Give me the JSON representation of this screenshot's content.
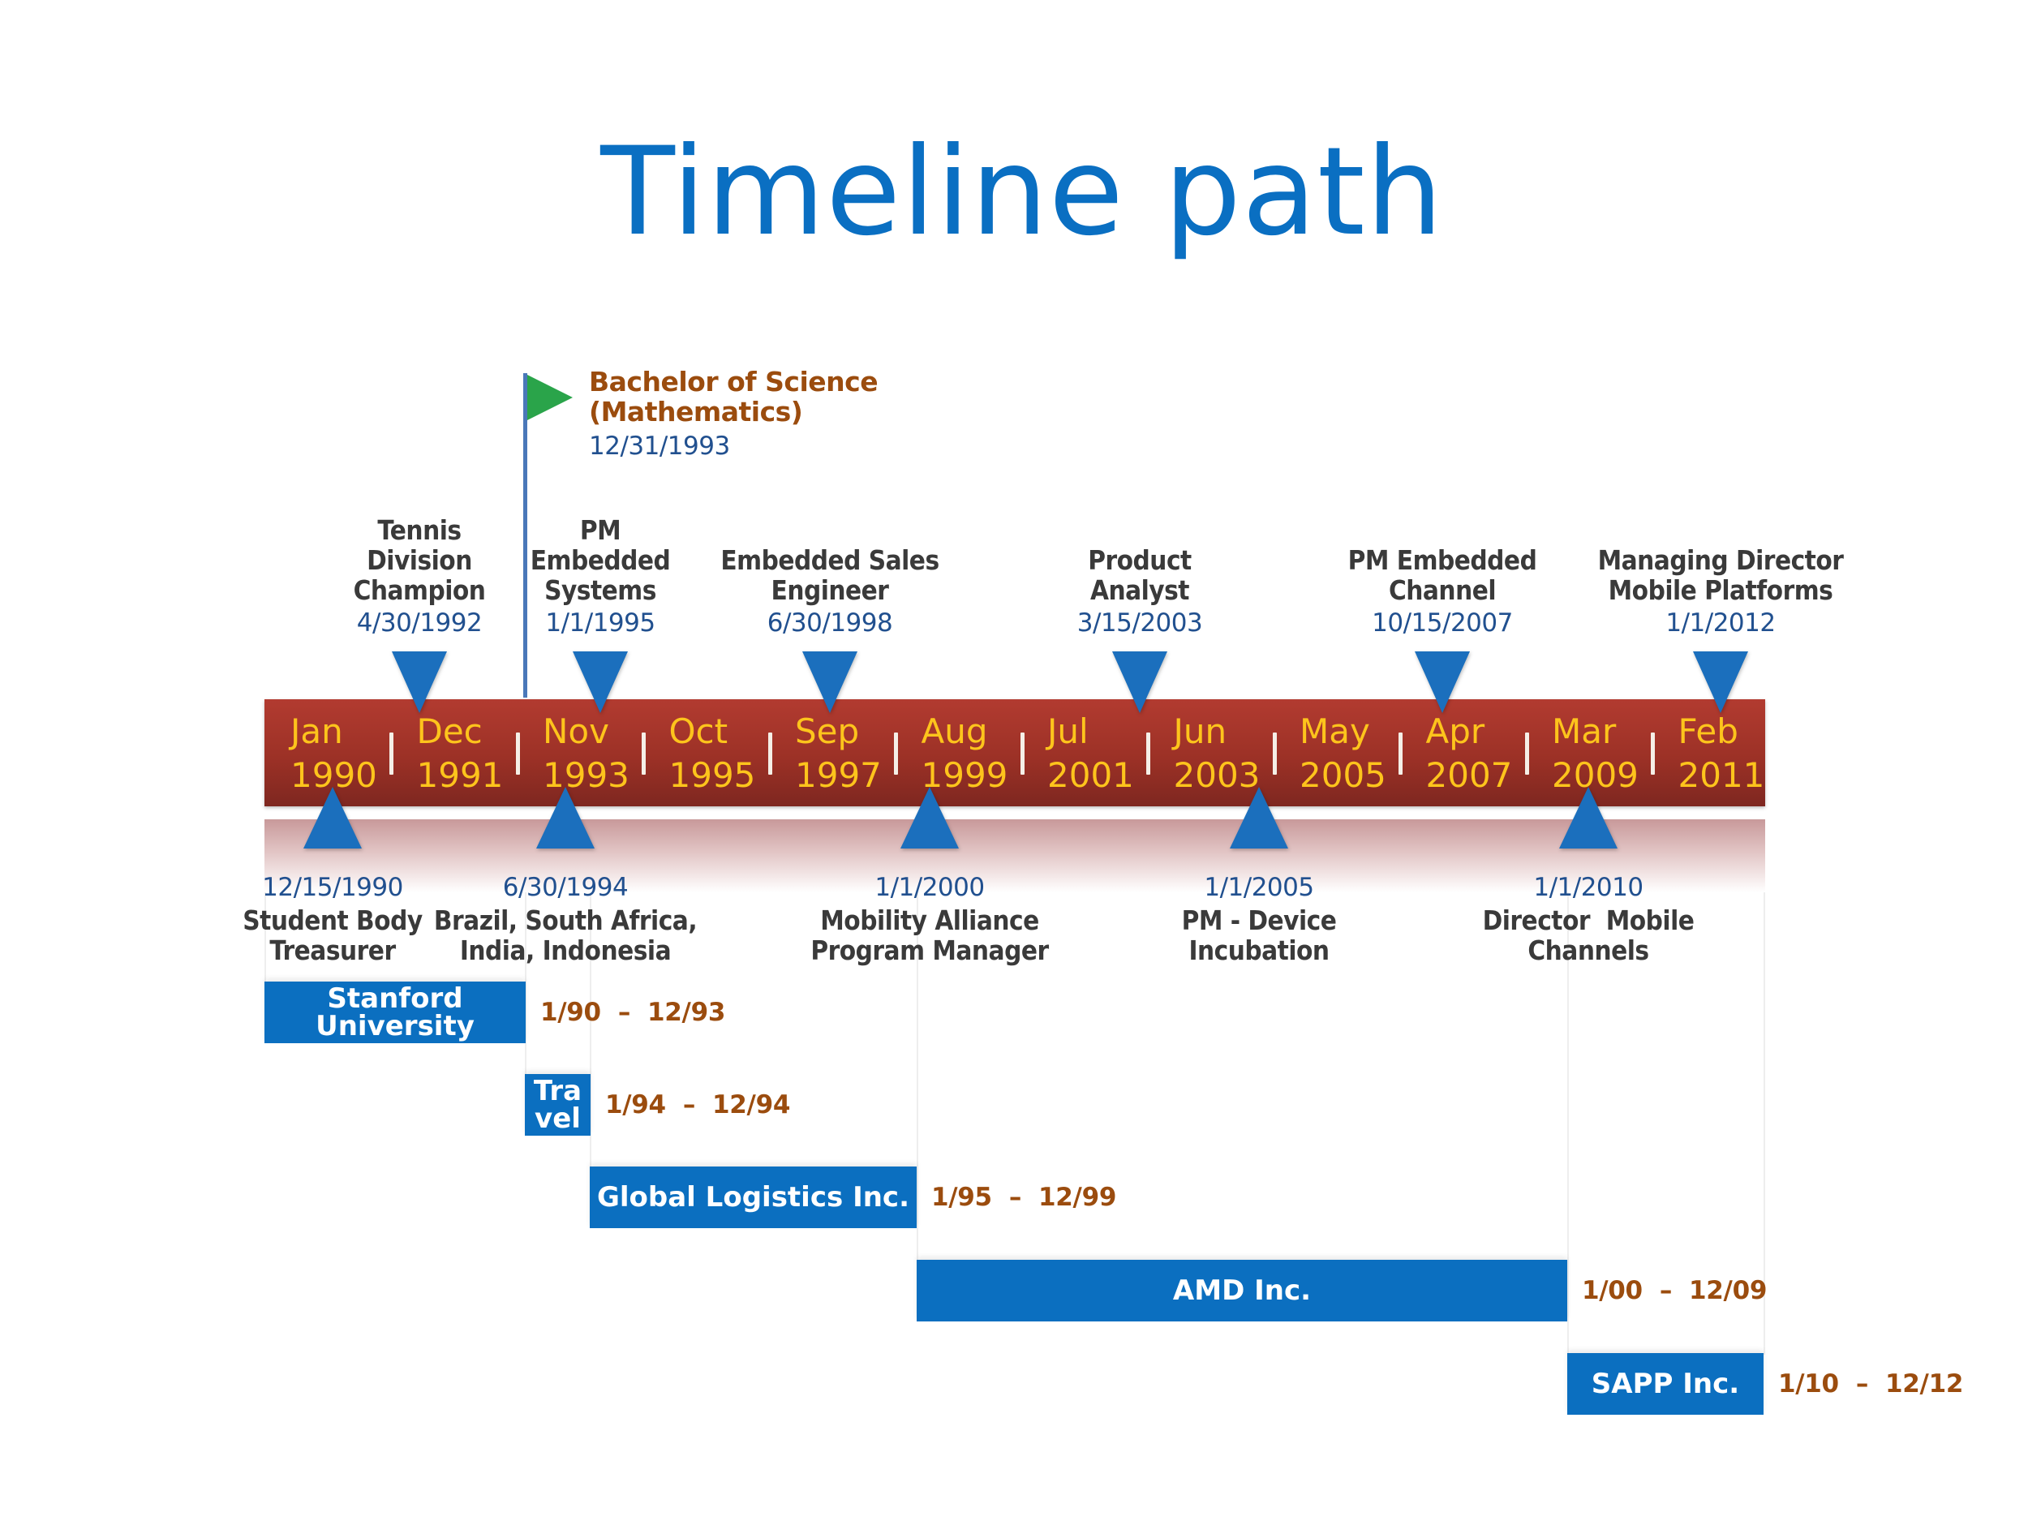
{
  "title": "Timeline path",
  "colors": {
    "title": "#0a6fc2",
    "bar": "#9c3126",
    "period_text": "#fdc41c",
    "marker": "#1b6fbd",
    "flag": "#2aa44a",
    "flag_text": "#9b4c0e",
    "date_text": "#21508f",
    "gantt_bar": "#0b6fc0",
    "range_text": "#9b4c0e"
  },
  "timeline": {
    "periods": [
      {
        "month": "Jan",
        "year": "1990"
      },
      {
        "month": "Dec",
        "year": "1991"
      },
      {
        "month": "Nov",
        "year": "1993"
      },
      {
        "month": "Oct",
        "year": "1995"
      },
      {
        "month": "Sep",
        "year": "1997"
      },
      {
        "month": "Aug",
        "year": "1999"
      },
      {
        "month": "Jul",
        "year": "2001"
      },
      {
        "month": "Jun",
        "year": "2003"
      },
      {
        "month": "May",
        "year": "2005"
      },
      {
        "month": "Apr",
        "year": "2007"
      },
      {
        "month": "Mar",
        "year": "2009"
      },
      {
        "month": "Feb",
        "year": "2011"
      }
    ]
  },
  "flag_milestone": {
    "icon": "flag-icon",
    "title_line1": "Bachelor of Science",
    "title_line2": "(Mathematics)",
    "date": "12/31/1993"
  },
  "milestones_above": [
    {
      "label": "Tennis\nDivision\nChampion",
      "date": "4/30/1992"
    },
    {
      "label": "PM\nEmbedded\nSystems",
      "date": "1/1/1995"
    },
    {
      "label": "Embedded Sales\nEngineer",
      "date": "6/30/1998"
    },
    {
      "label": "Product\nAnalyst",
      "date": "3/15/2003"
    },
    {
      "label": "PM Embedded\nChannel",
      "date": "10/15/2007"
    },
    {
      "label": "Managing Director\nMobile Platforms",
      "date": "1/1/2012"
    }
  ],
  "milestones_below": [
    {
      "label": "Student Body\nTreasurer",
      "date": "12/15/1990"
    },
    {
      "label": "Brazil, South Africa,\nIndia, Indonesia",
      "date": "6/30/1994"
    },
    {
      "label": "Mobility Alliance\nProgram Manager",
      "date": "1/1/2000"
    },
    {
      "label": "PM - Device\nIncubation",
      "date": "1/1/2005"
    },
    {
      "label": "Director  Mobile\nChannels",
      "date": "1/1/2010"
    }
  ],
  "phases": [
    {
      "name": "Stanford University",
      "name_display": "Stanford\nUniversity",
      "range": "1/90  –  12/93"
    },
    {
      "name": "Travel",
      "name_display": "Tra\nvel",
      "range": "1/94  –  12/94"
    },
    {
      "name": "Global Logistics Inc.",
      "name_display": "Global Logistics Inc.",
      "range": "1/95  –  12/99"
    },
    {
      "name": "AMD Inc.",
      "name_display": "AMD Inc.",
      "range": "1/00  –  12/09"
    },
    {
      "name": "SAPP Inc.",
      "name_display": "SAPP Inc.",
      "range": "1/10  –  12/12"
    }
  ]
}
